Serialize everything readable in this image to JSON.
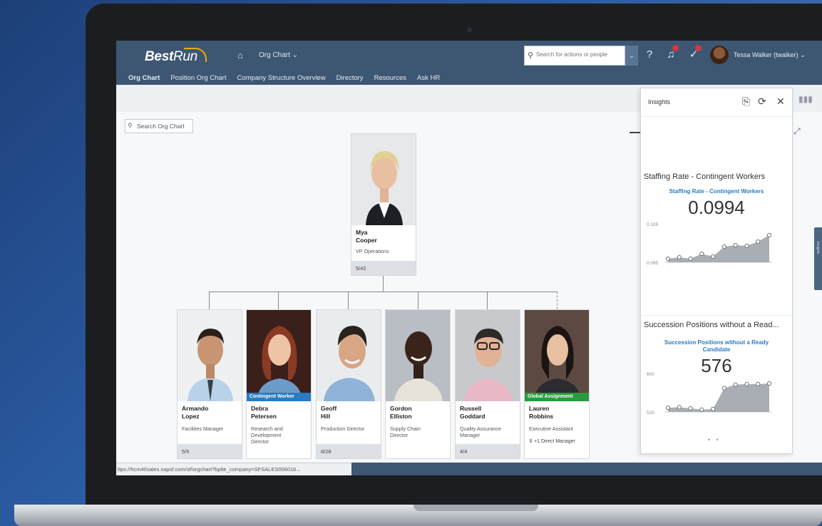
{
  "shell": {
    "logo_bold": "Best",
    "logo_rest": "Run",
    "app_title": "Org Chart ⌄",
    "search_placeholder": "Search for actions or people",
    "user_name": "Tessa Walker (twalker) ⌄",
    "icons": [
      "home-icon",
      "search-icon",
      "help-icon",
      "notification-icon",
      "todo-icon",
      "avatar"
    ]
  },
  "nav": {
    "items": [
      "Org Chart",
      "Position Org Chart",
      "Company Structure Overview",
      "Directory",
      "Resources",
      "Ask HR"
    ]
  },
  "org": {
    "search_placeholder": "Search Org Chart",
    "root": {
      "name": "Mya\nCooper",
      "title": "VP Operations",
      "count": "5/42"
    },
    "reports": [
      {
        "name": "Armando\nLopez",
        "title": "Facilities Manager",
        "count": "5/5",
        "tag": ""
      },
      {
        "name": "Debra\nPetersen",
        "title": "Research and\nDevelopment\nDirector",
        "count": "",
        "tag": "Contingent Worker"
      },
      {
        "name": "Geoff\nHill",
        "title": "Production Director",
        "count": "8/28",
        "tag": ""
      },
      {
        "name": "Gordon\nElliston",
        "title": "Supply Chain\nDirector",
        "count": "",
        "tag": ""
      },
      {
        "name": "Russell\nGoddard",
        "title": "Quality Assurance\nManager",
        "count": "4/4",
        "tag": ""
      },
      {
        "name": "Lauren\nRobbins",
        "title": "Executive Assistant",
        "count": "",
        "tag": "Global Assignment",
        "extra": "+1 Direct Manager"
      }
    ]
  },
  "insights": {
    "title": "Insights",
    "widget1": {
      "title": "Staffing Rate - Contingent Workers",
      "kpi_label": "Staffing Rate - Contingent Workers",
      "value": "0.0994",
      "axis_top": "0.105",
      "axis_bottom": "0.095",
      "series": [
        0.0955,
        0.0957,
        0.0955,
        0.0962,
        0.0958,
        0.0972,
        0.0974,
        0.0973,
        0.0979,
        0.0988
      ]
    },
    "widget2": {
      "title": "Succession Positions without a Read...",
      "kpi_label": "Succession Positions without a Ready\nCandidate",
      "value": "576",
      "axis_top": "600",
      "axis_bottom": "520",
      "series": [
        527,
        528,
        526,
        524,
        525,
        560,
        566,
        567,
        567,
        568
      ]
    },
    "pager": "• •"
  },
  "side_tab_label": "Insights",
  "status_url": "ttps://hcm40sales.sapsf.com/sf/orgchart?bplte_company=SFSALES006016...",
  "colors": {
    "shell": "#3d5773",
    "accent": "#2a7bbf",
    "contingent_tag": "#2a7bbf",
    "global_tag": "#2b9a3e",
    "sparkline_fill": "#a9aeb4"
  }
}
